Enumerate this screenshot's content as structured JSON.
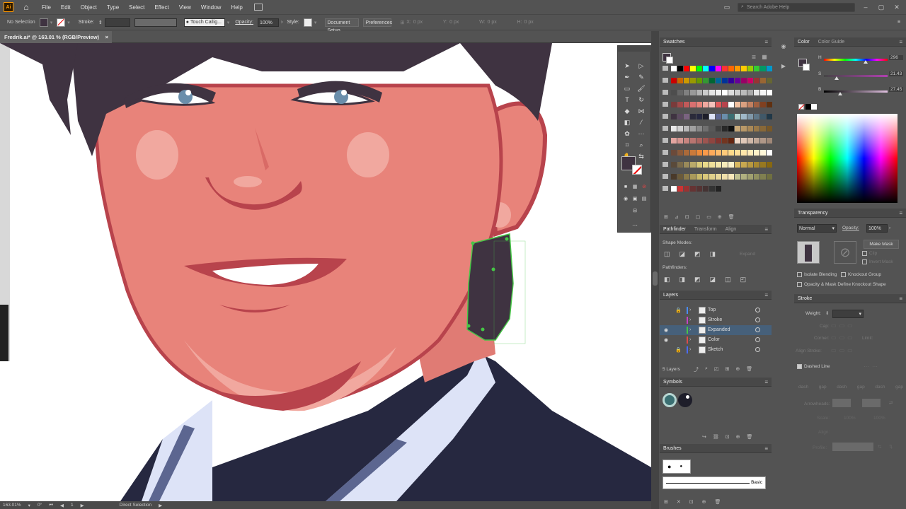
{
  "menubar": {
    "logo": "Ai",
    "items": [
      "File",
      "Edit",
      "Object",
      "Type",
      "Select",
      "Effect",
      "View",
      "Window",
      "Help"
    ],
    "search_placeholder": "Search Adobe Help"
  },
  "controlbar": {
    "selection_label": "No Selection",
    "stroke_label": "Stroke:",
    "brush_label": "Touch Callig...",
    "opacity_label": "Opacity:",
    "opacity_value": "100%",
    "style_label": "Style:",
    "doc_setup": "Document Setup",
    "preferences": "Preferences",
    "x_label": "X:",
    "x_value": "0 px",
    "y_label": "Y:",
    "y_value": "0 px",
    "w_label": "W:",
    "w_value": "0 px",
    "h_label": "H:",
    "h_value": "0 px"
  },
  "document": {
    "tab_title": "Fredrik.ai* @ 163.01 % (RGB/Preview)",
    "close": "×"
  },
  "status": {
    "zoom": "163.01%",
    "angle": "0°",
    "artboard": "1",
    "tool_name": "Direct Selection"
  },
  "swatches_panel": {
    "title": "Swatches"
  },
  "pathfinder_panel": {
    "tabs": [
      "Pathfinder",
      "Transform",
      "Align"
    ],
    "shape_modes": "Shape Modes:",
    "expand": "Expand",
    "pathfinders": "Pathfinders:"
  },
  "layers_panel": {
    "title": "Layers",
    "layers": [
      {
        "name": "Top",
        "color": "#4a8cff",
        "visible": false,
        "locked": true
      },
      {
        "name": "Stroke",
        "color": "#c643c6",
        "visible": false,
        "locked": false
      },
      {
        "name": "Expanded",
        "color": "#46c646",
        "visible": true,
        "locked": false,
        "selected": true
      },
      {
        "name": "Color",
        "color": "#e04a4a",
        "visible": true,
        "locked": false
      },
      {
        "name": "Sketch",
        "color": "#4a6cff",
        "visible": false,
        "locked": true
      }
    ],
    "count": "5 Layers"
  },
  "symbols_panel": {
    "title": "Symbols"
  },
  "brushes_panel": {
    "title": "Brushes",
    "basic": "Basic"
  },
  "color_panel": {
    "tabs": [
      "Color",
      "Color Guide"
    ],
    "h_label": "H",
    "h_value": "296",
    "s_label": "S",
    "s_value": "21.43",
    "b_label": "B",
    "b_value": "27.45"
  },
  "transparency_panel": {
    "title": "Transparency",
    "blend_mode": "Normal",
    "opacity_label": "Opacity:",
    "opacity_value": "100%",
    "make_mask": "Make Mask",
    "clip": "Clip",
    "invert_mask": "Invert Mask",
    "isolate": "Isolate Blending",
    "knockout": "Knockout Group",
    "opacity_mask": "Opacity & Mask Define Knockout Shape"
  },
  "stroke_panel": {
    "title": "Stroke",
    "weight_label": "Weight:",
    "cap": "Cap:",
    "corner": "Corner:",
    "limit": "Limit:",
    "align_stroke": "Align Stroke:",
    "dashed_line": "Dashed Line",
    "dash_labels": [
      "dash",
      "gap",
      "dash",
      "gap",
      "dash",
      "gap"
    ],
    "arrowheads": "Arrowheads:",
    "scale": "Scale:",
    "scale_values": [
      "100%",
      "100%"
    ],
    "align": "Align:",
    "profile": "Profile:"
  },
  "colors": {
    "skin": "#e8837a",
    "skin_light": "#f1a89f",
    "skin_dark": "#b8434c",
    "hair": "#3f3341",
    "suit": "#262840",
    "shirt": "#dde3f7",
    "lapel": "#5c6690",
    "selection": "#46c646"
  }
}
